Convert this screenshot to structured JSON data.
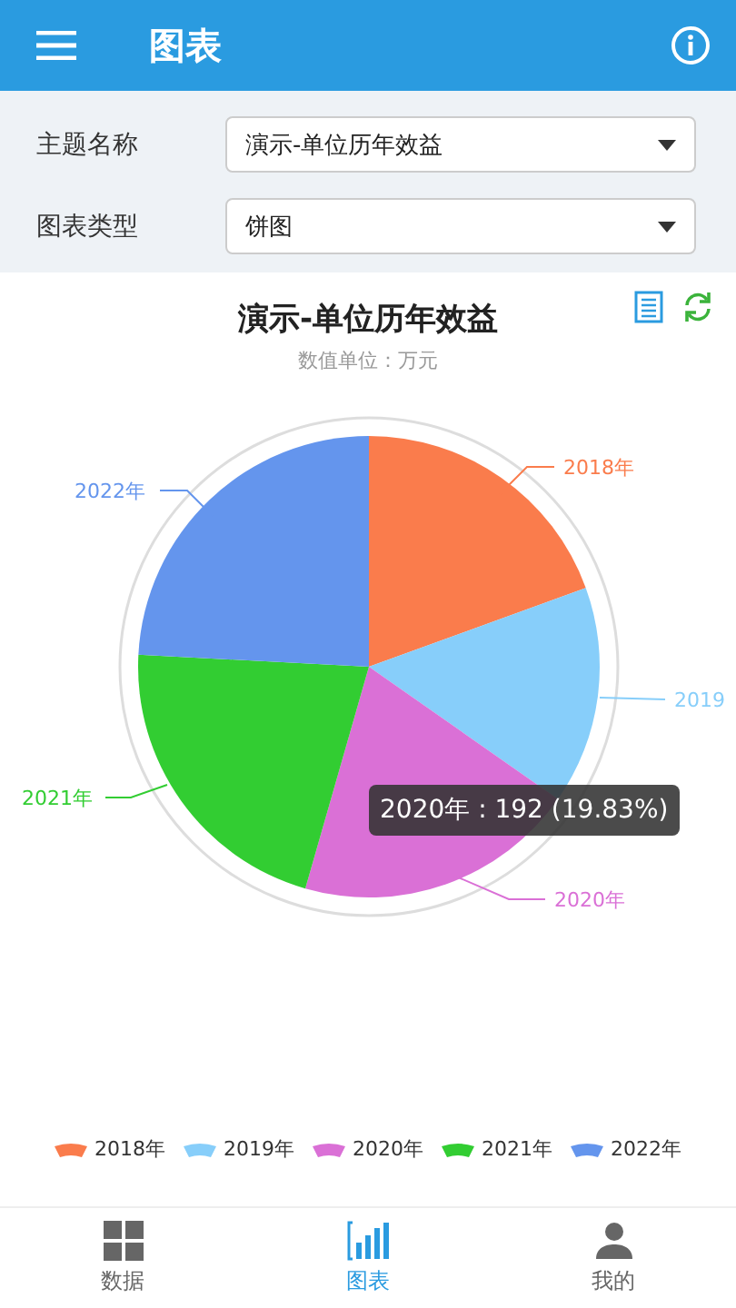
{
  "header": {
    "title": "图表"
  },
  "filters": [
    {
      "label": "主题名称",
      "value": "演示-单位历年效益"
    },
    {
      "label": "图表类型",
      "value": "饼图"
    }
  ],
  "chart": {
    "title": "演示-单位历年效益",
    "subtitle": "数值单位：万元",
    "slices": [
      {
        "label": "2018年",
        "color": "#fa7c4c"
      },
      {
        "label": "2019",
        "color": "#87cefa"
      },
      {
        "label": "2020年",
        "color": "#da70d6"
      },
      {
        "label": "2021年",
        "color": "#32cd32"
      },
      {
        "label": "2022年",
        "color": "#6495ed"
      }
    ],
    "tooltip": "2020年 : 192 (19.83%)",
    "legend": [
      {
        "label": "2018年",
        "color": "#fa7c4c"
      },
      {
        "label": "2019年",
        "color": "#87cefa"
      },
      {
        "label": "2020年",
        "color": "#da70d6"
      },
      {
        "label": "2021年",
        "color": "#32cd32"
      },
      {
        "label": "2022年",
        "color": "#6495ed"
      }
    ]
  },
  "nav": [
    {
      "label": "数据",
      "kind": "grid",
      "selected": false
    },
    {
      "label": "图表",
      "kind": "chart",
      "selected": true
    },
    {
      "label": "我的",
      "kind": "person",
      "selected": false
    }
  ]
}
